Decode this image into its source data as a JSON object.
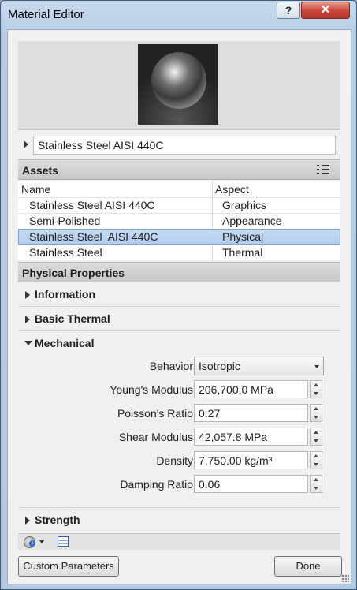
{
  "window": {
    "title": "Material Editor",
    "help_label": "?",
    "close_label": "✕"
  },
  "material": {
    "name": "Stainless Steel AISI 440C"
  },
  "assets": {
    "header": "Assets",
    "columns": [
      "Name",
      "Aspect"
    ],
    "rows": [
      {
        "name": "Stainless Steel AISI 440C",
        "aspect": "Graphics"
      },
      {
        "name": "Semi-Polished",
        "aspect": "Appearance"
      },
      {
        "name": "Stainless Steel  AISI 440C",
        "aspect": "Physical"
      },
      {
        "name": "Stainless Steel",
        "aspect": "Thermal"
      }
    ],
    "selected_row": 2
  },
  "physical": {
    "header": "Physical Properties",
    "groups": {
      "information": "Information",
      "basic_thermal": "Basic Thermal",
      "mechanical": "Mechanical",
      "strength": "Strength"
    },
    "behavior": {
      "label": "Behavior",
      "value": "Isotropic"
    },
    "youngs_modulus": {
      "label": "Young's Modulus",
      "value": "206,700.0 MPa"
    },
    "poissons_ratio": {
      "label": "Poisson's Ratio",
      "value": "0.27"
    },
    "shear_modulus": {
      "label": "Shear Modulus",
      "value": "42,057.8 MPa"
    },
    "density": {
      "label": "Density",
      "value": "7,750.00 kg/m³"
    },
    "damping_ratio": {
      "label": "Damping Ratio",
      "value": "0.06"
    }
  },
  "buttons": {
    "custom_parameters": "Custom Parameters",
    "done": "Done"
  },
  "colors": {
    "selection": "#b4cdee",
    "titlebar": "#c9daee",
    "close": "#c9443a"
  }
}
